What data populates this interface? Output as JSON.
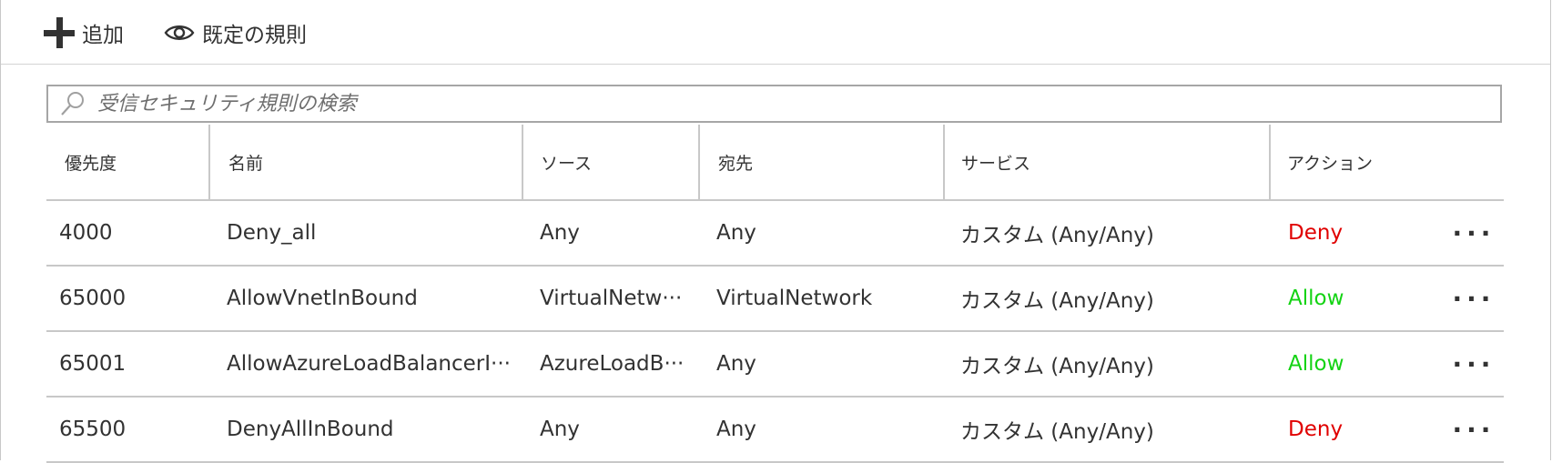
{
  "toolbar": {
    "add_label": "追加",
    "default_rules_label": "既定の規則",
    "icons": [
      "plus-icon",
      "eye-icon"
    ]
  },
  "search": {
    "placeholder": "受信セキュリティ規則の検索",
    "value": ""
  },
  "table": {
    "columns": [
      "優先度",
      "名前",
      "ソース",
      "宛先",
      "サービス",
      "アクション"
    ],
    "rows": [
      {
        "priority": "4000",
        "name": "Deny_all",
        "source": "Any",
        "destination": "Any",
        "service": "カスタム (Any/Any)",
        "action": "Deny",
        "more": "···"
      },
      {
        "priority": "65000",
        "name": "AllowVnetInBound",
        "source": "VirtualNetw···",
        "destination": "VirtualNetwork",
        "service": "カスタム (Any/Any)",
        "action": "Allow",
        "more": "···"
      },
      {
        "priority": "65001",
        "name": "AllowAzureLoadBalancerI···",
        "source": "AzureLoadB···",
        "destination": "Any",
        "service": "カスタム (Any/Any)",
        "action": "Allow",
        "more": "···"
      },
      {
        "priority": "65500",
        "name": "DenyAllInBound",
        "source": "Any",
        "destination": "Any",
        "service": "カスタム (Any/Any)",
        "action": "Deny",
        "more": "···"
      }
    ]
  },
  "colors": {
    "deny": "#e00000",
    "allow": "#13d313",
    "border": "#c8c8c8",
    "text": "#323232"
  }
}
